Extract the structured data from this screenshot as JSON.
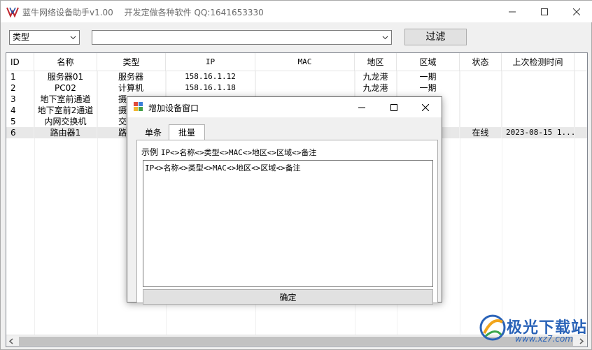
{
  "window": {
    "title": "蓝牛网络设备助手v1.00",
    "subtitle": "开发定做各种软件 QQ:1641653330"
  },
  "toolbar": {
    "type_select": "类型",
    "filter_value": "",
    "filter_button": "过滤"
  },
  "table": {
    "columns": [
      "ID",
      "名称",
      "类型",
      "IP",
      "MAC",
      "地区",
      "区域",
      "状态",
      "上次检测时间"
    ],
    "rows": [
      {
        "id": "1",
        "name": "服务器01",
        "type": "服务器",
        "ip": "158.16.1.12",
        "mac": "",
        "region": "九龙港",
        "area": "一期",
        "status": "",
        "last_check": ""
      },
      {
        "id": "2",
        "name": "PC02",
        "type": "计算机",
        "ip": "158.16.1.18",
        "mac": "",
        "region": "九龙港",
        "area": "一期",
        "status": "",
        "last_check": ""
      },
      {
        "id": "3",
        "name": "地下室前通道",
        "type": "摄",
        "ip": "",
        "mac": "",
        "region": "",
        "area": "",
        "status": "",
        "last_check": ""
      },
      {
        "id": "4",
        "name": "地下室前2通道",
        "type": "摄",
        "ip": "",
        "mac": "",
        "region": "",
        "area": "",
        "status": "",
        "last_check": ""
      },
      {
        "id": "5",
        "name": "内网交换机",
        "type": "交",
        "ip": "",
        "mac": "",
        "region": "",
        "area": "",
        "status": "",
        "last_check": ""
      },
      {
        "id": "6",
        "name": "路由器1",
        "type": "路",
        "ip": "",
        "mac": "",
        "region": "",
        "area": "",
        "status": "在线",
        "last_check": "2023-08-15 1..."
      }
    ]
  },
  "dialog": {
    "title": "增加设备窗口",
    "tabs": [
      "单条",
      "批量"
    ],
    "active_tab": "批量",
    "example_label": "示例",
    "example_format": "IP<>名称<>类型<>MAC<>地区<>区域<>备注",
    "textarea_value": "IP<>名称<>类型<>MAC<>地区<>区域<>备注",
    "confirm_button": "确定"
  },
  "watermark": {
    "text": "极光下载站",
    "url": "www.xz7.com"
  }
}
